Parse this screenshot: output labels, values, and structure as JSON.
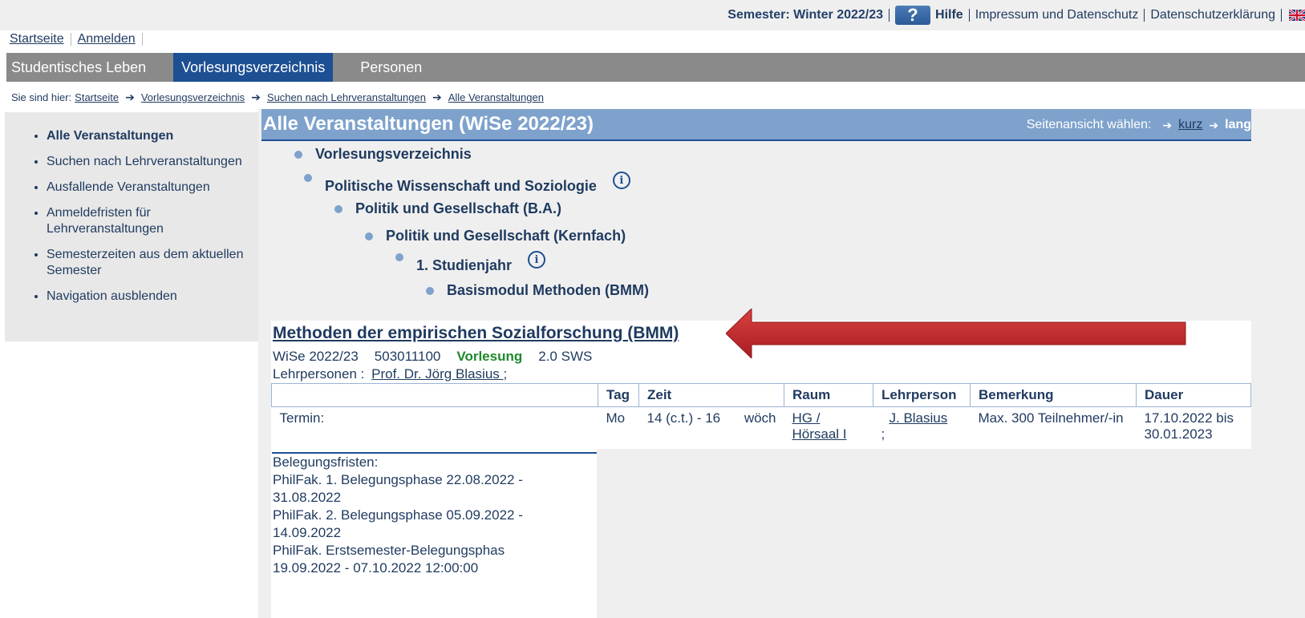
{
  "topbar": {
    "semester": "Semester: Winter 2022/23",
    "help_icon_glyph": "?",
    "help": "Hilfe",
    "impressum": "Impressum und Datenschutz",
    "datenschutz": "Datenschutzerklärung",
    "language_icon": "uk-flag-icon"
  },
  "toplinks": {
    "home": "Startseite",
    "login": "Anmelden"
  },
  "mainnav": {
    "tabs": [
      {
        "label": "Studentisches Leben"
      },
      {
        "label": "Vorlesungsverzeichnis"
      },
      {
        "label": "Personen"
      }
    ]
  },
  "breadcrumb": {
    "label": "Sie sind hier:",
    "items": [
      "Startseite",
      "Vorlesungsverzeichnis",
      "Suchen nach Lehrveranstaltungen",
      "Alle Veranstaltungen"
    ]
  },
  "sidebar": {
    "items": [
      "Alle Veranstaltungen",
      "Suchen nach Lehrveranstaltungen",
      "Ausfallende Veranstaltungen",
      "Anmeldefristen für Lehrveranstaltungen",
      "Semesterzeiten aus dem aktuellen Semester",
      "Navigation ausblenden"
    ]
  },
  "content": {
    "title": "Alle Veranstaltungen (WiSe 2022/23)",
    "view_label": "Seitenansicht wählen:",
    "view_short": "kurz",
    "view_long": "lang",
    "tree": [
      "Vorlesungsverzeichnis",
      "Politische Wissenschaft und Soziologie",
      "Politik und Gesellschaft (B.A.)",
      "Politik und Gesellschaft (Kernfach)",
      "1. Studienjahr",
      "Basismodul Methoden (BMM)"
    ],
    "info_glyph": "i"
  },
  "course": {
    "title": "Methoden der empirischen Sozialforschung (BMM)",
    "semester": "WiSe 2022/23",
    "number": "503011100",
    "type": "Vorlesung",
    "sws": "2.0 SWS",
    "lehrpersonen_label": "Lehrpersonen :",
    "lehrperson": "Prof. Dr. Jörg Blasius ",
    "lehrperson_sep": ";",
    "table": {
      "headers": [
        "",
        "Tag",
        "Zeit",
        "Raum",
        "Lehrperson",
        "Bemerkung",
        "Dauer"
      ],
      "row": {
        "termin": "Termin:",
        "tag": "Mo",
        "zeit": "14 (c.t.) - 16",
        "rhythmus": "wöch",
        "raum": "HG / Hörsaal I",
        "lehrperson": "J. Blasius",
        "lehrperson_sep": ";",
        "bemerkung": "Max. 300 Teilnehmer/-in",
        "dauer": "17.10.2022 bis 30.01.2023"
      }
    },
    "belegungsfristen": [
      "Belegungsfristen:",
      "PhilFak. 1. Belegungsphase 22.08.2022 -",
      "31.08.2022",
      "PhilFak. 2. Belegungsphase 05.09.2022 -",
      "14.09.2022",
      "PhilFak. Erstsemester-Belegungsphas",
      "19.09.2022 - 07.10.2022 12:00:00"
    ]
  },
  "colors": {
    "nav_gray": "#8a8a8a",
    "nav_active": "#1d4f93",
    "header_blue": "#7ea2cc",
    "type_green": "#1e8a2c",
    "annotation_red": "#c0262a"
  }
}
